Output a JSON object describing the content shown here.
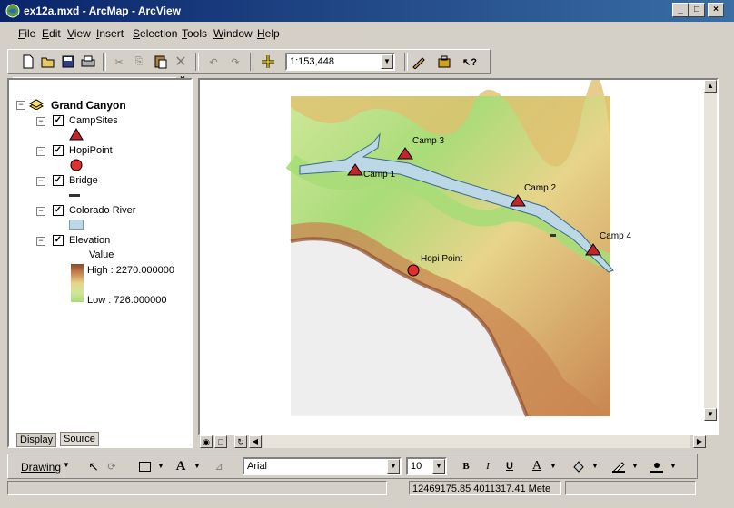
{
  "window": {
    "title": "ex12a.mxd - ArcMap - ArcView",
    "controls": [
      "_",
      "□",
      "×"
    ]
  },
  "menu": [
    "File",
    "Edit",
    "View",
    "Insert",
    "Selection",
    "Tools",
    "Window",
    "Help"
  ],
  "standard_toolbar": {
    "scale": "1:153,448",
    "buttons": [
      "new-icon",
      "open-icon",
      "save-icon",
      "print-icon",
      "cut-icon",
      "copy-icon",
      "paste-icon",
      "delete-icon",
      "undo-icon",
      "redo-icon",
      "add-data-icon",
      "editor-toolbar-icon",
      "arctoolbox-icon",
      "whats-this-icon"
    ]
  },
  "toc": {
    "dataframe": "Grand Canyon",
    "layers": [
      {
        "name": "CampSites",
        "checked": true,
        "symbol": "triangle"
      },
      {
        "name": "HopiPoint",
        "checked": true,
        "symbol": "circle"
      },
      {
        "name": "Bridge",
        "checked": true,
        "symbol": "line"
      },
      {
        "name": "Colorado River",
        "checked": true,
        "symbol": "polygon"
      },
      {
        "name": "Elevation",
        "checked": true,
        "symbol": "ramp"
      }
    ],
    "elevation_legend": {
      "value_label": "Value",
      "high": "High : 2270.000000",
      "low": "Low : 726.000000"
    },
    "tabs": [
      "Display",
      "Source"
    ]
  },
  "map": {
    "camps": [
      "Camp 1",
      "Camp 2",
      "Camp 3",
      "Camp 4"
    ],
    "hopi_label": "Hopi Point",
    "colors": {
      "river": "#bcd8e6",
      "river_stroke": "#3a6a86",
      "camp": "#c0272d",
      "hopi": "#e03030",
      "high": "#8b4a2b",
      "low": "#a9dc78"
    }
  },
  "drawing_toolbar": {
    "drawing_label": "Drawing",
    "font": "Arial",
    "font_size": "10",
    "bold": "B",
    "italic": "I",
    "underline": "U",
    "font_color": "A"
  },
  "status": {
    "coordinates": "12469175.85  4011317.41 Mete"
  }
}
